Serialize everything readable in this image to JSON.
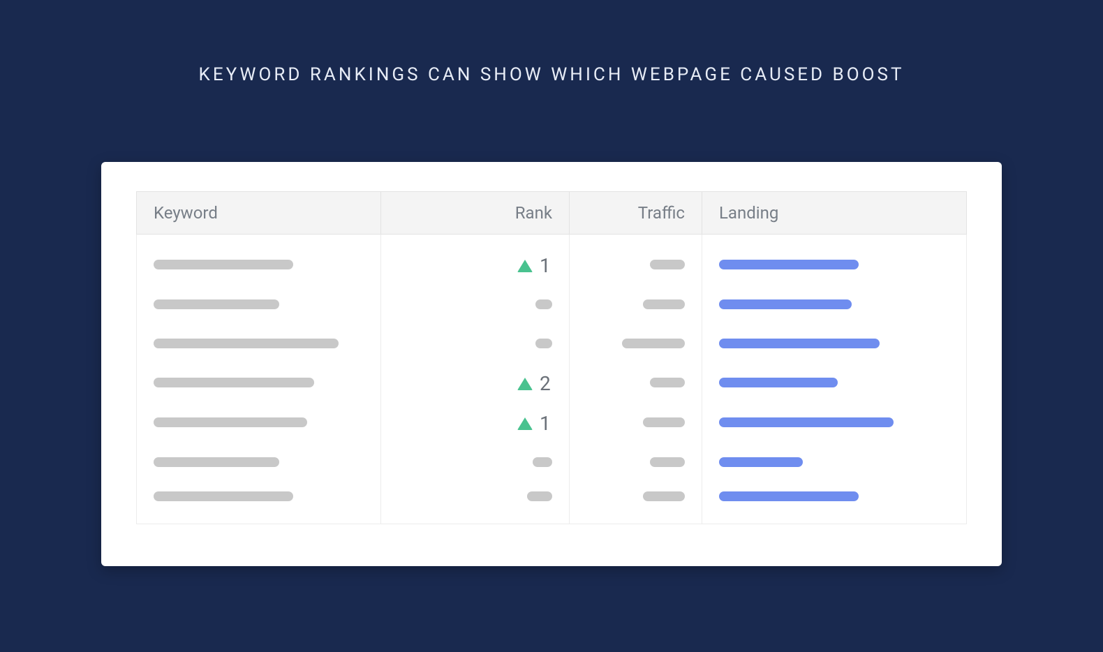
{
  "title": "KEYWORD RANKINGS CAN SHOW WHICH WEBPAGE CAUSED BOOST",
  "columns": {
    "keyword": "Keyword",
    "rank": "Rank",
    "traffic": "Traffic",
    "landing": "Landing"
  },
  "rows": [
    {
      "keyword_w": 200,
      "rank_num": "1",
      "rank_up": true,
      "rank_ph_w": 0,
      "traffic_w": 50,
      "landing_w": 200
    },
    {
      "keyword_w": 180,
      "rank_num": "",
      "rank_up": false,
      "rank_ph_w": 24,
      "traffic_w": 60,
      "landing_w": 190
    },
    {
      "keyword_w": 265,
      "rank_num": "",
      "rank_up": false,
      "rank_ph_w": 24,
      "traffic_w": 90,
      "landing_w": 230
    },
    {
      "keyword_w": 230,
      "rank_num": "2",
      "rank_up": true,
      "rank_ph_w": 0,
      "traffic_w": 50,
      "landing_w": 170
    },
    {
      "keyword_w": 220,
      "rank_num": "1",
      "rank_up": true,
      "rank_ph_w": 0,
      "traffic_w": 60,
      "landing_w": 250
    },
    {
      "keyword_w": 180,
      "rank_num": "",
      "rank_up": false,
      "rank_ph_w": 28,
      "traffic_w": 50,
      "landing_w": 120
    },
    {
      "keyword_w": 200,
      "rank_num": "",
      "rank_up": false,
      "rank_ph_w": 36,
      "traffic_w": 60,
      "landing_w": 200
    }
  ]
}
